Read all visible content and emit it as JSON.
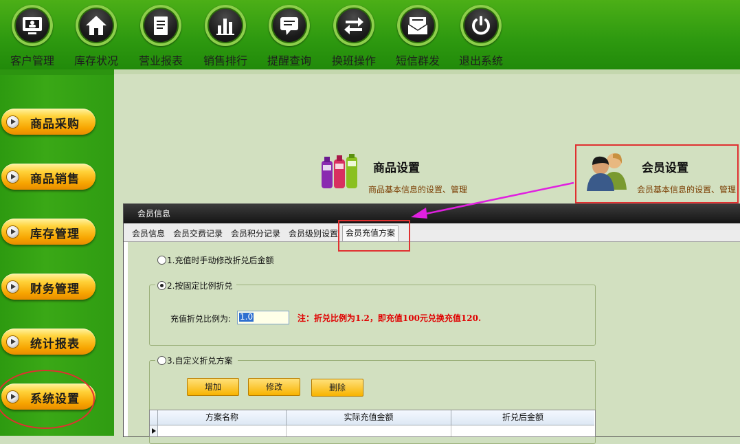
{
  "toolbar": {
    "items": [
      {
        "label": "客户管理",
        "icon": "monitor-icon"
      },
      {
        "label": "库存状况",
        "icon": "house-icon"
      },
      {
        "label": "营业报表",
        "icon": "document-icon"
      },
      {
        "label": "销售排行",
        "icon": "bar-chart-icon"
      },
      {
        "label": "提醒查询",
        "icon": "speech-bubble-icon"
      },
      {
        "label": "换班操作",
        "icon": "swap-arrows-icon"
      },
      {
        "label": "短信群发",
        "icon": "envelope-icon"
      },
      {
        "label": "退出系统",
        "icon": "power-icon"
      }
    ]
  },
  "sidebar": {
    "items": [
      {
        "label": "商品采购"
      },
      {
        "label": "商品销售"
      },
      {
        "label": "库存管理"
      },
      {
        "label": "财务管理"
      },
      {
        "label": "统计报表"
      },
      {
        "label": "系统设置"
      }
    ]
  },
  "modules": {
    "product": {
      "title": "商品设置",
      "desc": "商品基本信息的设置、管理"
    },
    "member": {
      "title": "会员设置",
      "desc": "会员基本信息的设置、管理"
    }
  },
  "dialog": {
    "title": "会员信息",
    "tabs": [
      {
        "label": "会员信息"
      },
      {
        "label": "会员交费记录"
      },
      {
        "label": "会员积分记录"
      },
      {
        "label": "会员级别设置"
      },
      {
        "label": "会员充值方案"
      }
    ],
    "option1": "1.充值时手动修改折兑后金额",
    "option2": "2.按固定比例折兑",
    "rate_label": "充值折兑比例为:",
    "rate_value": "1.0",
    "note": "注：折兑比例为1.2，即充值100元兑换充值120.",
    "option3": "3.自定义折兑方案",
    "buttons": {
      "add": "增加",
      "edit": "修改",
      "delete": "删除"
    },
    "columns": [
      "方案名称",
      "实际充值金额",
      "折兑后金额"
    ]
  },
  "colors": {
    "accent_green": "#2f9a10",
    "button_orange": "#f7a400",
    "note_red": "#e00000",
    "highlight_red": "#e03030",
    "arrow_magenta": "#e020e0"
  }
}
